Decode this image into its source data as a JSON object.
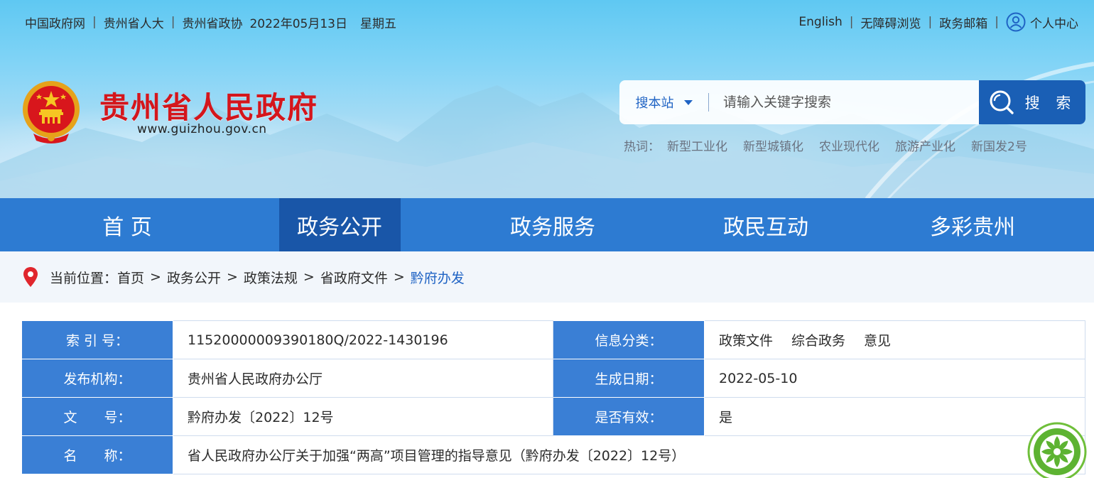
{
  "topbar": {
    "links_left": [
      "中国政府网",
      "贵州省人大",
      "贵州省政协"
    ],
    "date": "2022年05月13日",
    "weekday": "星期五",
    "links_right": [
      "English",
      "无障碍浏览",
      "政务邮箱"
    ],
    "user_center": "个人中心"
  },
  "brand": {
    "title": "贵州省人民政府",
    "url": "www.guizhou.gov.cn"
  },
  "search": {
    "scope": "搜本站",
    "placeholder": "请输入关键字搜索",
    "button": "搜 索",
    "hot_label": "热词：",
    "hot_words": [
      "新型工业化",
      "新型城镇化",
      "农业现代化",
      "旅游产业化",
      "新国发2号"
    ]
  },
  "nav": {
    "items": [
      "首 页",
      "政务公开",
      "政务服务",
      "政民互动",
      "多彩贵州"
    ],
    "active_index": 1
  },
  "breadcrumb": {
    "label": "当前位置：",
    "items": [
      "首页",
      "政务公开",
      "政策法规",
      "省政府文件"
    ],
    "current": "黔府办发"
  },
  "info": {
    "index_label": "索 引 号：",
    "index_value": "11520000009390180Q/2022-1430196",
    "category_label": "信息分类：",
    "category_values": [
      "政策文件",
      "综合政务",
      "意见"
    ],
    "publisher_label": "发布机构：",
    "publisher_value": "贵州省人民政府办公厅",
    "date_label": "生成日期：",
    "date_value": "2022-05-10",
    "docno_label": "文　　号：",
    "docno_value": "黔府办发〔2022〕12号",
    "valid_label": "是否有效：",
    "valid_value": "是",
    "name_label": "名　　称：",
    "name_value": "省人民政府办公厅关于加强“两高”项目管理的指导意见（黔府办发〔2022〕12号）"
  },
  "colors": {
    "nav_bg": "#2d7bd2",
    "nav_active": "#1956a8",
    "title_red": "#d4161c",
    "label_bg": "#3a7fd5",
    "search_btn": "#1a5fb5"
  }
}
